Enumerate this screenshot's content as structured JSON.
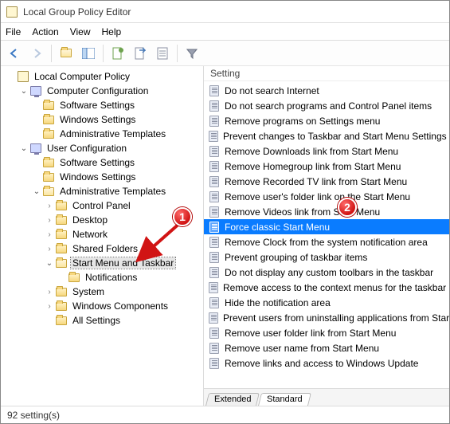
{
  "title": "Local Group Policy Editor",
  "menus": [
    "File",
    "Action",
    "View",
    "Help"
  ],
  "toolbar_icons": [
    "back",
    "forward",
    "up",
    "panels",
    "new",
    "export",
    "refresh",
    "help",
    "filter"
  ],
  "tree": {
    "root": "Local Computer Policy",
    "computer_config": "Computer Configuration",
    "cc_children": [
      "Software Settings",
      "Windows Settings",
      "Administrative Templates"
    ],
    "user_config": "User Configuration",
    "uc_children": [
      "Software Settings",
      "Windows Settings"
    ],
    "admin_templates": "Administrative Templates",
    "at_children_before": [
      "Control Panel",
      "Desktop",
      "Network",
      "Shared Folders"
    ],
    "start_menu_taskbar": "Start Menu and Taskbar",
    "notifications": "Notifications",
    "at_children_after": [
      "System",
      "Windows Components",
      "All Settings"
    ]
  },
  "list_header": "Setting",
  "settings": [
    {
      "label": "Do not search Internet",
      "selected": false
    },
    {
      "label": "Do not search programs and Control Panel items",
      "selected": false
    },
    {
      "label": "Remove programs on Settings menu",
      "selected": false
    },
    {
      "label": "Prevent changes to Taskbar and Start Menu Settings",
      "selected": false
    },
    {
      "label": "Remove Downloads link from Start Menu",
      "selected": false
    },
    {
      "label": "Remove Homegroup link from Start Menu",
      "selected": false
    },
    {
      "label": "Remove Recorded TV link from Start Menu",
      "selected": false
    },
    {
      "label": "Remove user's folder link on the Start Menu",
      "selected": false
    },
    {
      "label": "Remove Videos link from Start Menu",
      "selected": false
    },
    {
      "label": "Force classic Start Menu",
      "selected": true
    },
    {
      "label": "Remove Clock from the system notification area",
      "selected": false
    },
    {
      "label": "Prevent grouping of taskbar items",
      "selected": false
    },
    {
      "label": "Do not display any custom toolbars in the taskbar",
      "selected": false
    },
    {
      "label": "Remove access to the context menus for the taskbar",
      "selected": false
    },
    {
      "label": "Hide the notification area",
      "selected": false
    },
    {
      "label": "Prevent users from uninstalling applications from Start",
      "selected": false
    },
    {
      "label": "Remove user folder link from Start Menu",
      "selected": false
    },
    {
      "label": "Remove user name from Start Menu",
      "selected": false
    },
    {
      "label": "Remove links and access to Windows Update",
      "selected": false
    }
  ],
  "tabs": {
    "extended": "Extended",
    "standard": "Standard",
    "active": "standard"
  },
  "status": "92 setting(s)",
  "annotations": {
    "b1": "1",
    "b2": "2"
  }
}
